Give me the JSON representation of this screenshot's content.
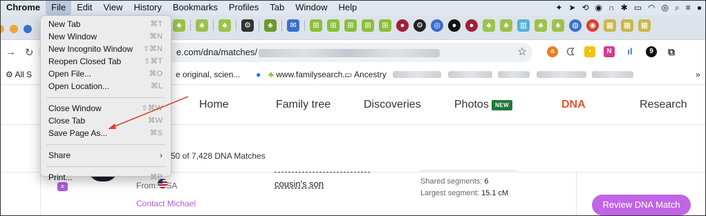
{
  "menubar": {
    "app": "Chrome",
    "items": [
      "File",
      "Edit",
      "View",
      "History",
      "Bookmarks",
      "Profiles",
      "Tab",
      "Window",
      "Help"
    ]
  },
  "file_menu": {
    "items": [
      {
        "label": "New Tab",
        "shortcut": "⌘T"
      },
      {
        "label": "New Window",
        "shortcut": "⌘N"
      },
      {
        "label": "New Incognito Window",
        "shortcut": "⇧⌘N"
      },
      {
        "label": "Reopen Closed Tab",
        "shortcut": "⇧⌘T"
      },
      {
        "label": "Open File...",
        "shortcut": "⌘O"
      },
      {
        "label": "Open Location...",
        "shortcut": "⌘L"
      },
      {
        "label": "Close Window",
        "shortcut": "⇧⌘W"
      },
      {
        "label": "Close Tab",
        "shortcut": "⌘W"
      },
      {
        "label": "Save Page As...",
        "shortcut": "⌘S"
      },
      {
        "label": "Share",
        "shortcut": "›"
      },
      {
        "label": "Print...",
        "shortcut": "⌘P"
      }
    ]
  },
  "toolbar": {
    "url_visible": "e.com/dna/matches/"
  },
  "bookmarks": {
    "all": "All S",
    "item1": "e original, scien...",
    "item2": "www.familysearch...",
    "item3": "Ancestry",
    "more": "»"
  },
  "site_nav": {
    "home": "Home",
    "family_tree": "Family tree",
    "discoveries": "Discoveries",
    "photos": "Photos",
    "new_badge": "NEW",
    "dna": "DNA",
    "research": "Research"
  },
  "matches": {
    "count_text": "50 of 7,428 DNA Matches"
  },
  "match_card": {
    "from": "From: USA",
    "contact": "Contact Michael",
    "relationship": "cousin's son",
    "shared_segments_label": "Shared segments:",
    "shared_segments_value": "6",
    "largest_segment_label": "Largest segment:",
    "largest_segment_value": "15.1 cM",
    "review_button": "Review DNA Match"
  },
  "colors": {
    "dna_accent": "#e8522e",
    "review_button": "#c065e6",
    "new_badge": "#1f7a3a",
    "annotation_arrow": "#e0442f"
  }
}
